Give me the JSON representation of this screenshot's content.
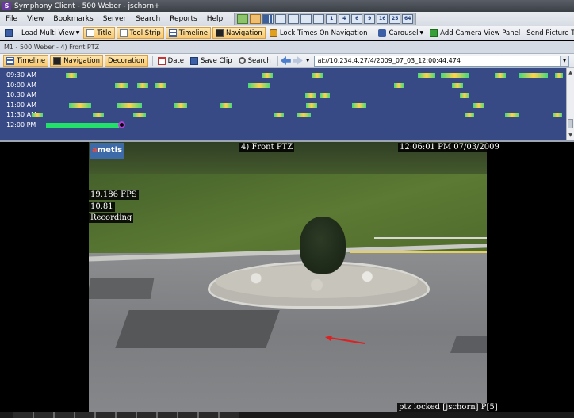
{
  "window": {
    "title": "Symphony Client - 500 Weber - jschorn+",
    "app_icon": "S"
  },
  "menu": [
    "File",
    "View",
    "Bookmarks",
    "Server",
    "Search",
    "Reports",
    "Help"
  ],
  "menu_layout_icons": [
    "1",
    "4",
    "6",
    "9",
    "16",
    "25",
    "64"
  ],
  "toolbar": {
    "load_multi_view": "Load Multi View",
    "title": "Title",
    "tool_strip": "Tool Strip",
    "timeline": "Timeline",
    "navigation": "Navigation",
    "lock_times": "Lock Times On Navigation",
    "carousel": "Carousel",
    "add_camera_view_panel": "Add Camera View Panel",
    "send_picture_to": "Send Picture To"
  },
  "tab": {
    "label": "M1 - 500 Weber - 4) Front PTZ"
  },
  "panel_toolbar": {
    "timeline": "Timeline",
    "navigation": "Navigation",
    "decoration": "Decoration",
    "date": "Date",
    "save_clip": "Save Clip",
    "search": "Search",
    "address": "ai://10.234.4.27/4/2009_07_03_12:00:44.474"
  },
  "timeline": {
    "rows": [
      {
        "label": "09:30 AM",
        "segments": [
          [
            83,
            14
          ],
          [
            330,
            14
          ],
          [
            393,
            14
          ],
          [
            527,
            22
          ],
          [
            556,
            35
          ],
          [
            624,
            14
          ],
          [
            655,
            36
          ],
          [
            700,
            10
          ]
        ]
      },
      {
        "label": "10:00 AM",
        "segments": [
          [
            145,
            16
          ],
          [
            173,
            14
          ],
          [
            196,
            14
          ],
          [
            313,
            28
          ],
          [
            497,
            12
          ],
          [
            570,
            14
          ]
        ]
      },
      {
        "label": "10:30 AM",
        "segments": [
          [
            385,
            14
          ],
          [
            404,
            12
          ],
          [
            580,
            12
          ]
        ]
      },
      {
        "label": "11:00 AM",
        "segments": [
          [
            87,
            28
          ],
          [
            147,
            32
          ],
          [
            220,
            16
          ],
          [
            278,
            14
          ],
          [
            386,
            14
          ],
          [
            444,
            18
          ],
          [
            597,
            14
          ]
        ]
      },
      {
        "label": "11:30 AM",
        "segments": [
          [
            40,
            14
          ],
          [
            117,
            14
          ],
          [
            168,
            16
          ],
          [
            346,
            12
          ],
          [
            374,
            18
          ],
          [
            586,
            12
          ],
          [
            637,
            18
          ],
          [
            697,
            12
          ]
        ]
      },
      {
        "label": "12:00 PM",
        "segments": [
          [
            58,
            92
          ]
        ],
        "cursor": 150
      }
    ]
  },
  "video": {
    "camera_name": "4) Front PTZ",
    "timestamp": "12:06:01 PM 07/03/2009",
    "fps": "19.186 FPS",
    "bitrate": "10.81",
    "status": "Recording",
    "ptz_status": "ptz locked [jschorn] P[5]",
    "logo_prefix": "a",
    "logo_rest": "metis"
  },
  "colors": {
    "timeline_bg": "#374a86",
    "segment_green": "#22e06a",
    "toolbar_active": "#f7c871",
    "cursor_ring": "#b43fd6"
  }
}
